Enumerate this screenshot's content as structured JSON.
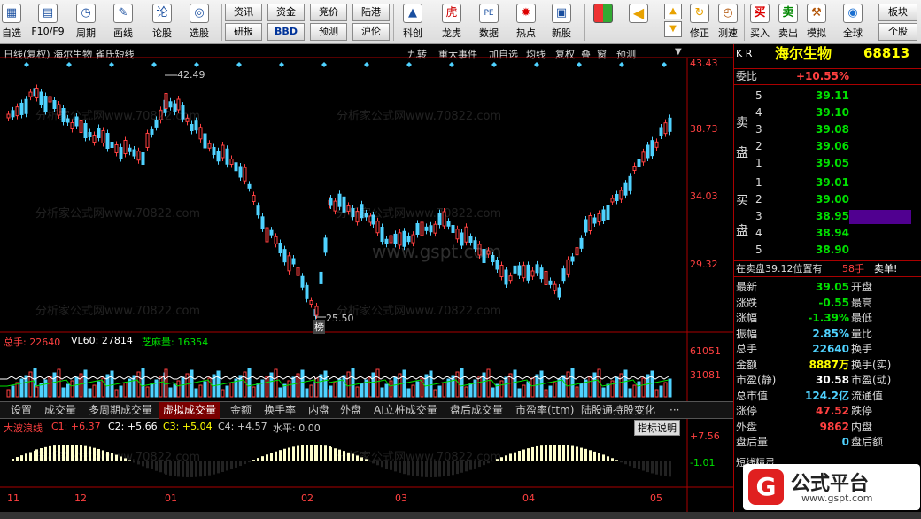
{
  "toolbar": {
    "items": [
      {
        "label": "自选",
        "icon": "▦"
      },
      {
        "label": "F10/F9",
        "icon": "▤"
      },
      {
        "label": "周期",
        "icon": "◷"
      },
      {
        "label": "画线",
        "icon": "✎"
      },
      {
        "label": "论股",
        "icon": "论"
      },
      {
        "label": "选股",
        "icon": "◎"
      }
    ],
    "buttons_top": [
      "资讯",
      "资金",
      "竞价",
      "陆港"
    ],
    "buttons_bottom": [
      "研报",
      "BBD",
      "预测",
      "沪伦"
    ],
    "items2": [
      {
        "label": "科创",
        "icon": "▲"
      },
      {
        "label": "龙虎",
        "icon": "虎"
      },
      {
        "label": "数据",
        "icon": "PE"
      },
      {
        "label": "热点",
        "icon": "✹"
      },
      {
        "label": "新股",
        "icon": "▣"
      }
    ],
    "items3": [
      {
        "label": "修正",
        "icon": "↻"
      },
      {
        "label": "测速",
        "icon": "◴"
      },
      {
        "label": "买入",
        "icon": "买"
      },
      {
        "label": "卖出",
        "icon": "卖"
      },
      {
        "label": "模拟",
        "icon": "⚒"
      },
      {
        "label": "全球",
        "icon": "◉"
      }
    ],
    "right_top": "板块",
    "right_bottom": "个股"
  },
  "chart": {
    "header": "日线(复权)  海尔生物  雀氏短线",
    "header_buttons": [
      "九转",
      "重大事件",
      "加自选",
      "均线",
      "复权",
      "叠",
      "窗",
      "预测"
    ],
    "price_axis": [
      "43.43",
      "38.73",
      "34.03",
      "29.32"
    ],
    "high_label": "42.49",
    "low_label": "25.50",
    "bang_label": "榜",
    "vol_line": {
      "zongshou_label": "总手: 22640",
      "vl60_label": "VL60: 27814",
      "zhima_label": "芝麻量: 16354"
    },
    "vol_axis": [
      "61051",
      "31081"
    ],
    "tabs": [
      "设置",
      "成交量",
      "多周期成交量",
      "虚拟成交量",
      "金额",
      "换手率",
      "内盘",
      "外盘",
      "AI立桩成交量",
      "盘后成交量",
      "市盈率(ttm)",
      "陆股通持股变化",
      "···"
    ],
    "active_tab": "虚拟成交量",
    "indicator_line": {
      "name": "大波浪线",
      "c1": "C1: +6.37",
      "c2": "C2: +5.66",
      "c3": "C3: +5.04",
      "c4": "C4: +4.57",
      "sp": "水平: 0.00"
    },
    "indicator_button": "指标说明",
    "ind_axis": [
      "+7.56",
      "-1.01"
    ],
    "dates": [
      "11",
      "12",
      "01",
      "02",
      "03",
      "04",
      "05"
    ]
  },
  "quote": {
    "kr": "K R",
    "name": "海尔生物",
    "code": "68813",
    "weibi_label": "委比",
    "weibi_value": "+10.55%",
    "sell_label": "卖盘",
    "buy_label": "买盘",
    "sell": [
      {
        "n": "5",
        "p": "39.11"
      },
      {
        "n": "4",
        "p": "39.10"
      },
      {
        "n": "3",
        "p": "39.08"
      },
      {
        "n": "2",
        "p": "39.06"
      },
      {
        "n": "1",
        "p": "39.05"
      }
    ],
    "buy": [
      {
        "n": "1",
        "p": "39.01"
      },
      {
        "n": "2",
        "p": "39.00"
      },
      {
        "n": "3",
        "p": "38.95"
      },
      {
        "n": "4",
        "p": "38.94"
      },
      {
        "n": "5",
        "p": "38.90"
      }
    ],
    "notice": "在卖盘39.12位置有",
    "notice_qty": "58手",
    "notice_suffix": "卖单!",
    "stats": [
      [
        "最新",
        "39.05",
        "开盘"
      ],
      [
        "涨跌",
        "-0.55",
        "最高"
      ],
      [
        "涨幅",
        "-1.39%",
        "最低"
      ],
      [
        "振幅",
        "2.85%",
        "量比"
      ],
      [
        "总手",
        "22640",
        "换手"
      ],
      [
        "金额",
        "8887万",
        "换手(实)"
      ],
      [
        "市盈(静)",
        "30.58",
        "市盈(动)"
      ],
      [
        "总市值",
        "124.2亿",
        "流通值"
      ],
      [
        "涨停",
        "47.52",
        "跌停"
      ],
      [
        "外盘",
        "9862",
        "内盘"
      ],
      [
        "盘后量",
        "0",
        "盘后额"
      ]
    ],
    "extra": "短线精灵"
  },
  "watermark": "分析家公式网www.70822.com",
  "watermark_center": "www.gspt.com",
  "logo_text": "公式平台",
  "logo_url": "www.gspt.com",
  "colors": {
    "up": "#ff4040",
    "down": "#4fd2ff",
    "accent": "#ffff00"
  }
}
